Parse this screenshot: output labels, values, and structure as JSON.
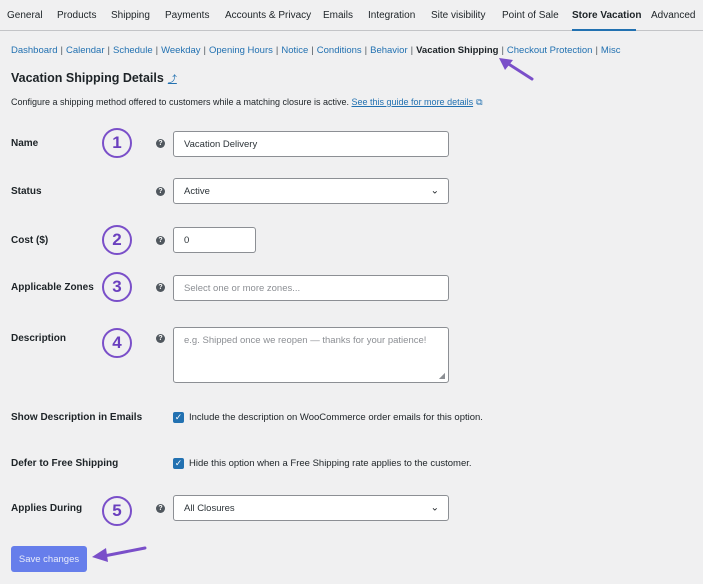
{
  "tabs": [
    "General",
    "Products",
    "Shipping",
    "Payments",
    "Accounts & Privacy",
    "Emails",
    "Integration",
    "Site visibility",
    "Point of Sale",
    "Store Vacation",
    "Advanced"
  ],
  "subnav": [
    "Dashboard",
    "Calendar",
    "Schedule",
    "Weekday",
    "Opening Hours",
    "Notice",
    "Conditions",
    "Behavior",
    "Vacation Shipping",
    "Checkout Protection",
    "Misc"
  ],
  "section": {
    "title": "Vacation Shipping Details",
    "intro_text": "Configure a shipping method offered to customers while a matching closure is active. ",
    "intro_link": "See this guide for more details"
  },
  "fields": {
    "name": {
      "label": "Name",
      "value": "Vacation Delivery",
      "step": "1"
    },
    "status": {
      "label": "Status",
      "value": "Active"
    },
    "cost": {
      "label": "Cost ($)",
      "value": "0",
      "step": "2"
    },
    "zones": {
      "label": "Applicable Zones",
      "placeholder": "Select one or more zones...",
      "step": "3"
    },
    "description": {
      "label": "Description",
      "placeholder": "e.g. Shipped once we reopen — thanks for your patience!",
      "step": "4"
    },
    "show_desc": {
      "label": "Show Description in Emails",
      "checkbox_text": "Include the description on WooCommerce order emails for this option.",
      "checked": true
    },
    "defer": {
      "label": "Defer to Free Shipping",
      "checkbox_text": "Hide this option when a Free Shipping rate applies to the customer.",
      "checked": true
    },
    "applies": {
      "label": "Applies During",
      "value": "All Closures",
      "step": "5"
    }
  },
  "save_label": "Save changes",
  "colors": {
    "accent": "#2271b1",
    "annotation": "#7a4fc9",
    "button": "#3858e9"
  }
}
